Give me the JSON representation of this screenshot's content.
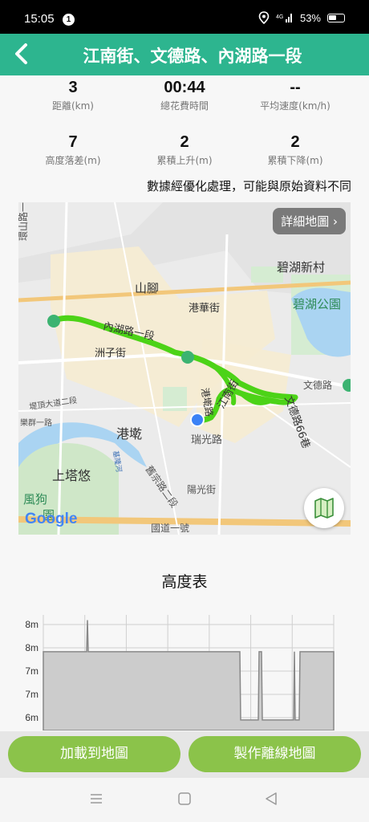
{
  "status": {
    "time": "15:05",
    "notification_count": "1",
    "battery": "53%",
    "network": "4G"
  },
  "header": {
    "title": "江南街、文德路、內湖路一段",
    "back_icon": "chevron-left-icon"
  },
  "stats": [
    {
      "value": "3",
      "label": "距離(km)"
    },
    {
      "value": "00:44",
      "label": "總花費時間"
    },
    {
      "value": "--",
      "label": "平均速度(km/h)"
    },
    {
      "value": "7",
      "label": "高度落差(m)"
    },
    {
      "value": "2",
      "label": "累積上升(m)"
    },
    {
      "value": "2",
      "label": "累積下降(m)"
    }
  ],
  "note": "數據經優化處理，可能與原始資料不同",
  "map": {
    "detail_button": "詳細地圖 ›",
    "attribution": "Google",
    "labels": [
      "碧湖新村",
      "碧湖公園",
      "山腳",
      "港華街",
      "內湖路一段",
      "洲子街",
      "文德路",
      "港墘路",
      "江南街",
      "瑞光路",
      "港墘",
      "上塔悠",
      "文德路66巷",
      "舊宗路二段",
      "陽光街",
      "國道一號",
      "環山路一段",
      "堤頂大道二段",
      "樂群一路",
      "基隆河",
      "風狗",
      "園"
    ],
    "route_color": "#4cd317",
    "current_location_color": "#3b82f6"
  },
  "elevation": {
    "title": "高度表",
    "y_ticks": [
      "8m",
      "8m",
      "7m",
      "7m",
      "6m"
    ]
  },
  "chart_data": {
    "type": "area",
    "title": "高度表",
    "ytick_labels": [
      "8m",
      "8m",
      "7m",
      "7m",
      "6m"
    ],
    "x": [
      0,
      10,
      20,
      40,
      50,
      54,
      55,
      56,
      57,
      60,
      100,
      200,
      240,
      245,
      246,
      268,
      269,
      272,
      273,
      312,
      313,
      314,
      315,
      316,
      317,
      319,
      320,
      362
    ],
    "values": [
      7.4,
      7.4,
      7.4,
      7.4,
      7.4,
      7.4,
      8.0,
      7.4,
      7.4,
      7.4,
      7.4,
      7.4,
      7.4,
      7.4,
      6.1,
      6.1,
      7.4,
      7.4,
      6.1,
      6.1,
      7.4,
      6.1,
      6.1,
      6.1,
      6.1,
      6.1,
      7.4,
      7.4
    ],
    "fill_color": "#cccccc",
    "line_color": "#888888"
  },
  "actions": {
    "load_to_map": "加載到地圖",
    "make_offline": "製作離線地圖"
  },
  "nav": [
    "menu-icon",
    "home-icon",
    "back-icon"
  ]
}
